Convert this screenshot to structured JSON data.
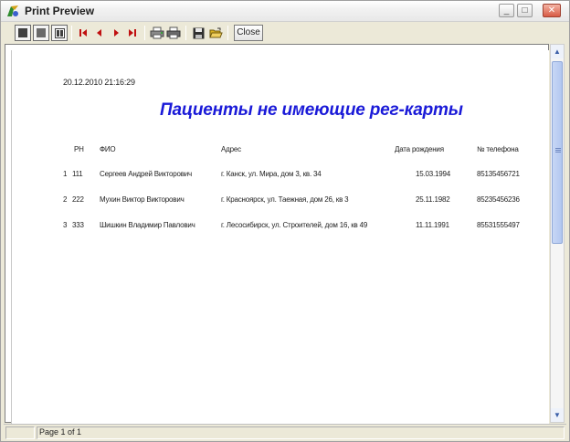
{
  "window": {
    "title": "Print Preview"
  },
  "title_buttons": [
    "_",
    "□",
    "✕"
  ],
  "toolbar": {
    "close_label": "Close"
  },
  "report": {
    "timestamp": "20.12.2010 21:16:29",
    "title": "Пациенты не имеющие рег-карты",
    "columns": {
      "num": "РН",
      "name": "ФИО",
      "address": "Адрес",
      "birth": "Дата рождения",
      "phone": "№ телефона"
    },
    "rows": [
      {
        "idx": "1",
        "num": "111",
        "name": "Сергеев Андрей Викторович",
        "address": "г. Канск, ул. Мира, дом 3, кв. 34",
        "birth": "15.03.1994",
        "phone": "85135456721"
      },
      {
        "idx": "2",
        "num": "222",
        "name": "Мухин Виктор Викторович",
        "address": "г. Красноярск, ул. Таежная, дом 26, кв 3",
        "birth": "25.11.1982",
        "phone": "85235456236"
      },
      {
        "idx": "3",
        "num": "333",
        "name": "Шишкин Владимир Павлович",
        "address": "г. Лесосибирск, ул. Строителей, дом 16, кв 49",
        "birth": "11.11.1991",
        "phone": "85531555497"
      }
    ]
  },
  "status": {
    "page": "Page 1 of 1"
  },
  "colors": {
    "title_blue": "#1a1ad8"
  },
  "icons": [
    "app-icon",
    "fit-page-icon",
    "actual-size-icon",
    "page-width-icon",
    "first-page-icon",
    "prev-page-icon",
    "next-page-icon",
    "last-page-icon",
    "printer-setup-icon",
    "print-icon",
    "save-icon",
    "open-icon"
  ]
}
